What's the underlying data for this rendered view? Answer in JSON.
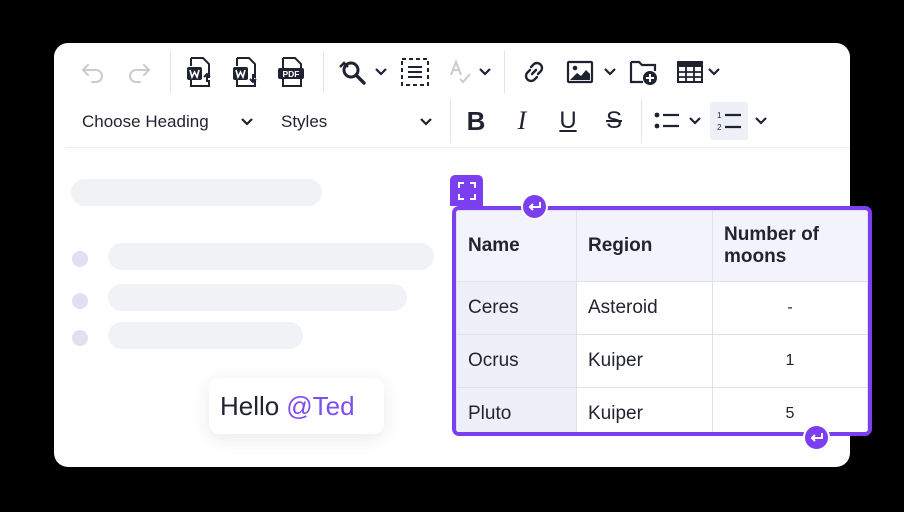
{
  "toolbar": {
    "heading_dropdown": "Choose Heading",
    "styles_dropdown": "Styles",
    "bold_label": "B",
    "italic_label": "I",
    "underline_label": "U",
    "strike_label": "S",
    "export_pdf_label": "PDF"
  },
  "editor": {
    "mention_greeting": "Hello",
    "mention_user": "@Ted"
  },
  "table": {
    "headers": [
      "Name",
      "Region",
      "Number of moons"
    ],
    "rows": [
      [
        "Ceres",
        "Asteroid",
        "-"
      ],
      [
        "Ocrus",
        "Kuiper",
        "1"
      ],
      [
        "Pluto",
        "Kuiper",
        "5"
      ]
    ]
  },
  "colors": {
    "accent": "#7c3ff0",
    "mention": "#7e4ff0",
    "background": "#000000"
  },
  "icons": [
    "undo-icon",
    "redo-icon",
    "import-word-icon",
    "export-word-icon",
    "export-pdf-icon",
    "find-replace-icon",
    "select-all-icon",
    "spellcheck-icon",
    "link-icon",
    "image-icon",
    "file-manager-icon",
    "table-icon",
    "bulleted-list-icon",
    "numbered-list-icon",
    "chevron-down-icon",
    "resize-handle-icon",
    "insert-paragraph-icon"
  ]
}
